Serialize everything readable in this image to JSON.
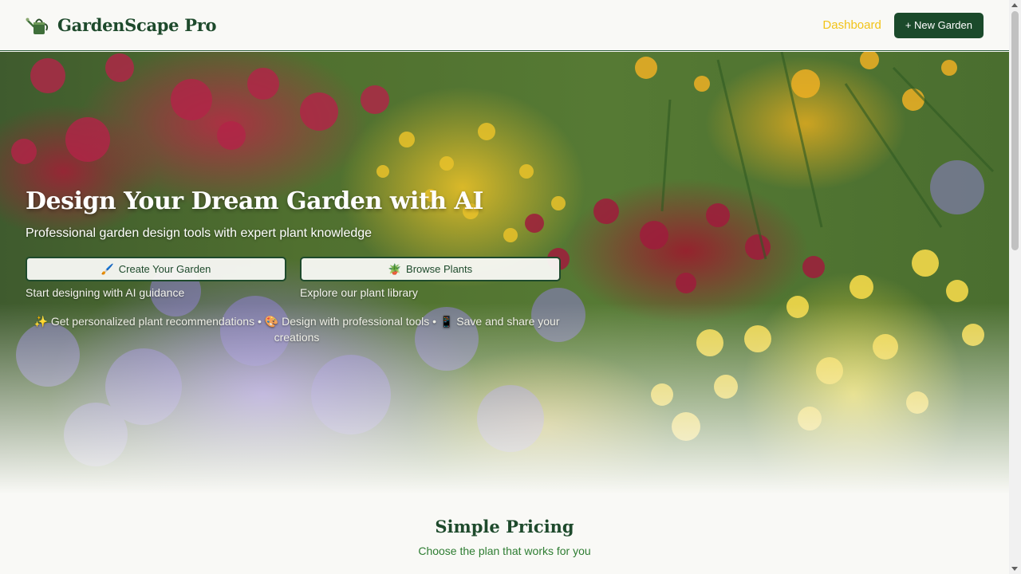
{
  "header": {
    "brand_name": "GardenScape Pro",
    "logo_icon": "watering-can-icon",
    "nav_dashboard": "Dashboard",
    "new_garden_label": "+ New Garden"
  },
  "hero": {
    "title": "Design Your Dream Garden with AI",
    "subtitle": "Professional garden design tools with expert plant knowledge",
    "cta_create": {
      "icon": "🖌️",
      "label": "Create Your Garden",
      "caption": "Start designing with AI guidance"
    },
    "cta_browse": {
      "icon": "🪴",
      "label": "Browse Plants",
      "caption": "Explore our plant library"
    },
    "features": "✨ Get personalized plant recommendations • 🎨 Design with professional tools • 📱 Save and share your creations"
  },
  "pricing": {
    "title": "Simple Pricing",
    "subtitle": "Choose the plan that works for you"
  },
  "colors": {
    "brand_green": "#1b4a2b",
    "accent_yellow": "#f2c318",
    "subtitle_green": "#2e7d32",
    "background": "#f9f9f6"
  }
}
